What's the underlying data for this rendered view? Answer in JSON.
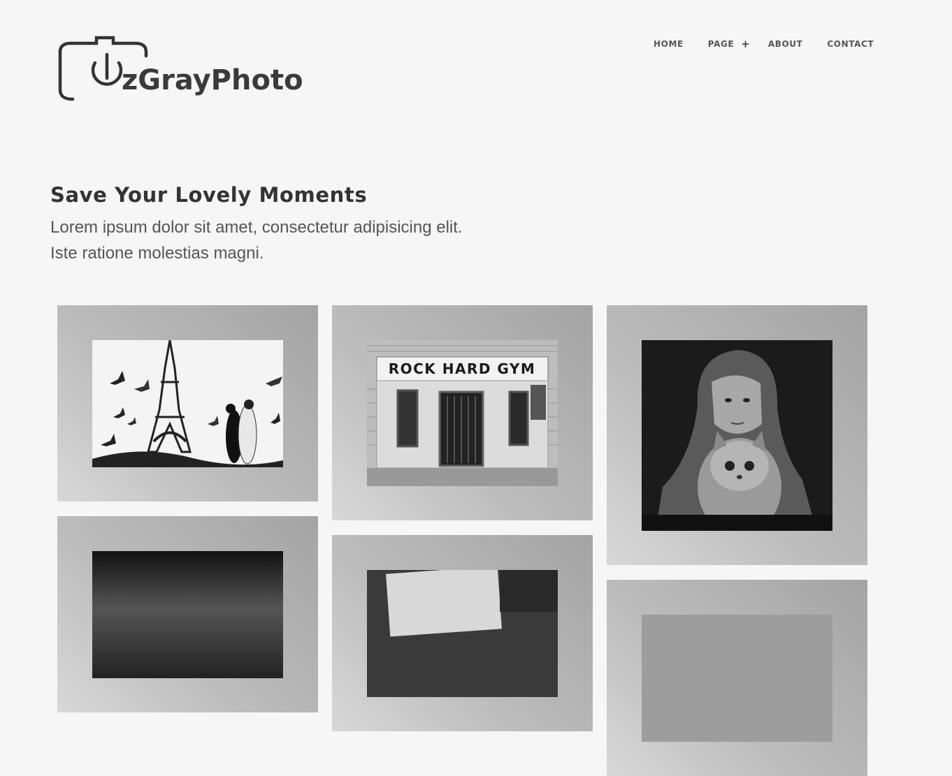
{
  "brand": {
    "logo_text": "zGrayPhoto"
  },
  "nav": {
    "items": [
      "HOME",
      "PAGE",
      "ABOUT",
      "CONTACT"
    ],
    "submenu_icon": "plus-icon"
  },
  "hero": {
    "title": "Save Your Lovely Moments",
    "line1": "Lorem ipsum dolor sit amet, consectetur adipisicing elit.",
    "line2": "Iste ratione molestias magni."
  },
  "gallery": {
    "photos": [
      {
        "subject": "Eiffel tower with couple and pigeons"
      },
      {
        "subject": "Rock hard gym storefront",
        "sign": "ROCK HARD GYM"
      },
      {
        "subject": "Girl in headscarf holding a cat"
      },
      {
        "subject": "Dark misty landscape"
      },
      {
        "subject": "Old papers"
      },
      {
        "subject": "Light photo"
      }
    ]
  },
  "colors": {
    "background": "#f6f6f6",
    "text": "#333333",
    "card_light": "#d8d8d8",
    "card_dark": "#a4a4a4"
  }
}
